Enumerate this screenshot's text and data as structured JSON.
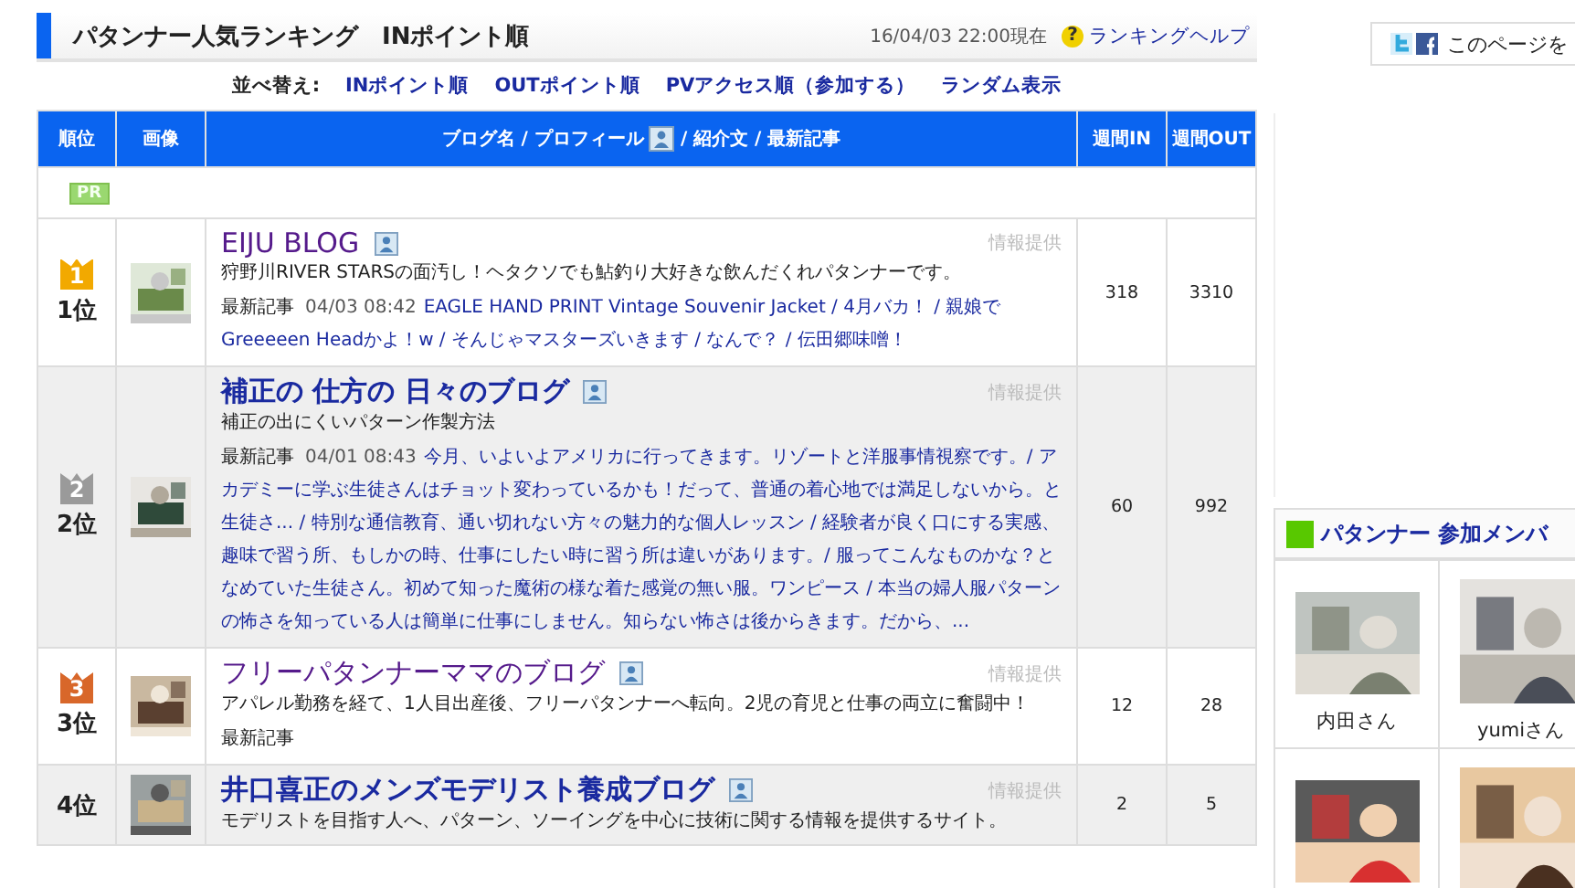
{
  "header": {
    "title": "パタンナー人気ランキング　INポイント順",
    "timestamp": "16/04/03 22:00現在",
    "help_icon": "?",
    "help_link": "ランキングヘルプ"
  },
  "sort": {
    "label": "並べ替え:",
    "links": [
      "INポイント順",
      "OUTポイント順",
      "PVアクセス順（参加する）",
      "ランダム表示"
    ]
  },
  "table": {
    "columns": {
      "rank": "順位",
      "image": "画像",
      "main_left": "ブログ名 / プロフィール",
      "main_right": "/ 紹介文 / 最新記事",
      "in": "週間IN",
      "out": "週間OUT"
    },
    "pr_badge": "PR",
    "rows": [
      {
        "kind": "gold",
        "medal_number": "1",
        "rank": "1位",
        "title": "EIJU BLOG",
        "visited": true,
        "info": "情報提供",
        "description": "狩野川RIVER STARSの面汚し！ヘタクソでも鮎釣り大好きな飲んだくれパタンナーです。",
        "latest_label": "最新記事",
        "latest_date": "04/03 08:42",
        "latest_text": "EAGLE HAND PRINT Vintage Souvenir Jacket / 4月バカ！ / 親娘でGreeeeen Headかよ！w / そんじゃマスターズいきます / なんで？ / 伝田郷味噌！",
        "in": "318",
        "out": "3310"
      },
      {
        "kind": "silver",
        "medal_number": "2",
        "rank": "2位",
        "title": "補正の 仕方の 日々のブログ",
        "visited": false,
        "info": "情報提供",
        "description": "補正の出にくいパターン作製方法",
        "latest_label": "最新記事",
        "latest_date": "04/01 08:43",
        "latest_text": "今月、いよいよアメリカに行ってきます。リゾートと洋服事情視察です。/ アカデミーに学ぶ生徒さんはチョット変わっているかも！だって、普通の着心地では満足しないから。と生徒さ... / 特別な通信教育、通い切れない方々の魅力的な個人レッスン / 経験者が良く口にする実感、趣味で習う所、もしかの時、仕事にしたい時に習う所は違いがあります。/ 服ってこんなものかな？となめていた生徒さん。初めて知った魔術の様な着た感覚の無い服。ワンピース / 本当の婦人服パターンの怖さを知っている人は簡単に仕事にしません。知らない怖さは後からきます。だから、...",
        "in": "60",
        "out": "992"
      },
      {
        "kind": "bronze",
        "medal_number": "3",
        "rank": "3位",
        "title": "フリーパタンナーママのブログ",
        "visited": true,
        "info": "情報提供",
        "description": "アパレル勤務を経て、1人目出産後、フリーパタンナーへ転向。2児の育児と仕事の両立に奮闘中！",
        "latest_label": "最新記事",
        "in": "12",
        "out": "28"
      },
      {
        "kind": "plain",
        "rank": "4位",
        "title": "井口喜正のメンズモデリスト養成ブログ",
        "visited": false,
        "info": "情報提供",
        "description": "モデリストを目指す人へ、パターン、ソーイングを中心に技術に関する情報を提供するサイト。",
        "in": "2",
        "out": "5"
      }
    ]
  },
  "share": {
    "label": "このページを"
  },
  "members": {
    "title": "パタンナー 参加メンバ",
    "items": [
      {
        "kind": "picture",
        "name": "内田さん"
      },
      {
        "kind": "picture",
        "name": "yumiさん"
      },
      {
        "kind": "picture"
      },
      {
        "kind": "picture"
      }
    ]
  }
}
